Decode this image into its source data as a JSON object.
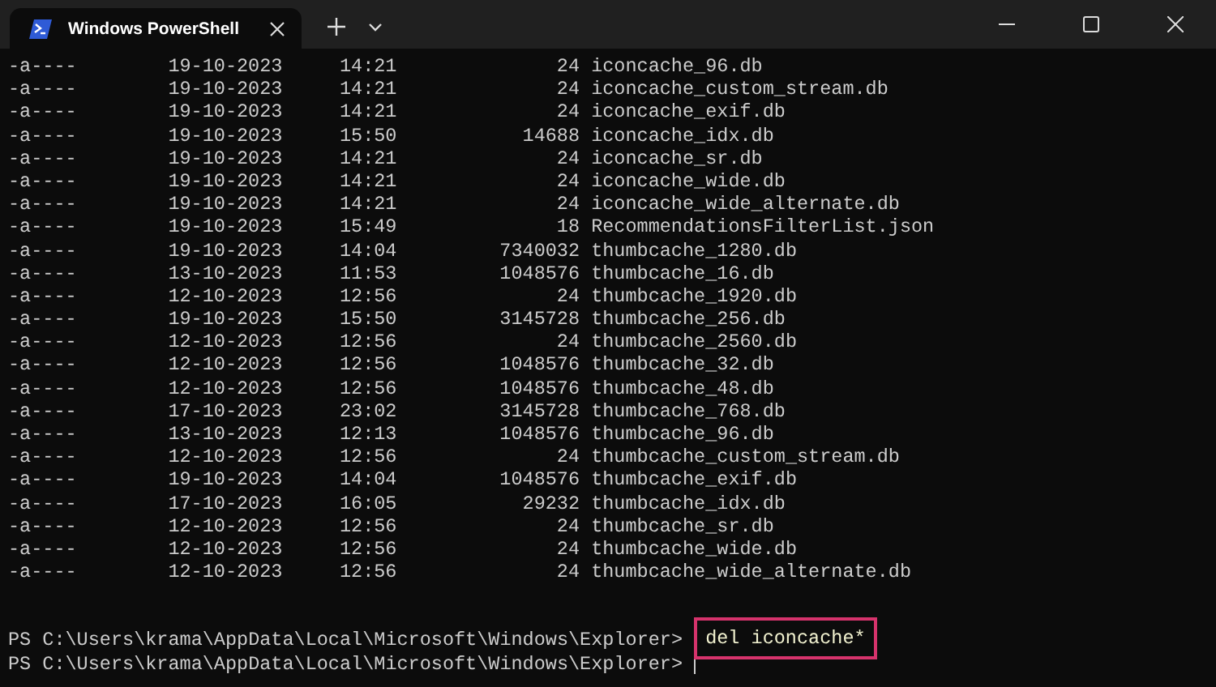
{
  "tabs": [
    {
      "title": "Windows PowerShell",
      "selected": true
    }
  ],
  "listing": [
    {
      "mode": "-a----",
      "date": "19-10-2023",
      "time": "14:21",
      "length": "24",
      "name": "iconcache_96.db"
    },
    {
      "mode": "-a----",
      "date": "19-10-2023",
      "time": "14:21",
      "length": "24",
      "name": "iconcache_custom_stream.db"
    },
    {
      "mode": "-a----",
      "date": "19-10-2023",
      "time": "14:21",
      "length": "24",
      "name": "iconcache_exif.db"
    },
    {
      "mode": "-a----",
      "date": "19-10-2023",
      "time": "15:50",
      "length": "14688",
      "name": "iconcache_idx.db"
    },
    {
      "mode": "-a----",
      "date": "19-10-2023",
      "time": "14:21",
      "length": "24",
      "name": "iconcache_sr.db"
    },
    {
      "mode": "-a----",
      "date": "19-10-2023",
      "time": "14:21",
      "length": "24",
      "name": "iconcache_wide.db"
    },
    {
      "mode": "-a----",
      "date": "19-10-2023",
      "time": "14:21",
      "length": "24",
      "name": "iconcache_wide_alternate.db"
    },
    {
      "mode": "-a----",
      "date": "19-10-2023",
      "time": "15:49",
      "length": "18",
      "name": "RecommendationsFilterList.json"
    },
    {
      "mode": "-a----",
      "date": "19-10-2023",
      "time": "14:04",
      "length": "7340032",
      "name": "thumbcache_1280.db"
    },
    {
      "mode": "-a----",
      "date": "13-10-2023",
      "time": "11:53",
      "length": "1048576",
      "name": "thumbcache_16.db"
    },
    {
      "mode": "-a----",
      "date": "12-10-2023",
      "time": "12:56",
      "length": "24",
      "name": "thumbcache_1920.db"
    },
    {
      "mode": "-a----",
      "date": "19-10-2023",
      "time": "15:50",
      "length": "3145728",
      "name": "thumbcache_256.db"
    },
    {
      "mode": "-a----",
      "date": "12-10-2023",
      "time": "12:56",
      "length": "24",
      "name": "thumbcache_2560.db"
    },
    {
      "mode": "-a----",
      "date": "12-10-2023",
      "time": "12:56",
      "length": "1048576",
      "name": "thumbcache_32.db"
    },
    {
      "mode": "-a----",
      "date": "12-10-2023",
      "time": "12:56",
      "length": "1048576",
      "name": "thumbcache_48.db"
    },
    {
      "mode": "-a----",
      "date": "17-10-2023",
      "time": "23:02",
      "length": "3145728",
      "name": "thumbcache_768.db"
    },
    {
      "mode": "-a----",
      "date": "13-10-2023",
      "time": "12:13",
      "length": "1048576",
      "name": "thumbcache_96.db"
    },
    {
      "mode": "-a----",
      "date": "12-10-2023",
      "time": "12:56",
      "length": "24",
      "name": "thumbcache_custom_stream.db"
    },
    {
      "mode": "-a----",
      "date": "19-10-2023",
      "time": "14:04",
      "length": "1048576",
      "name": "thumbcache_exif.db"
    },
    {
      "mode": "-a----",
      "date": "17-10-2023",
      "time": "16:05",
      "length": "29232",
      "name": "thumbcache_idx.db"
    },
    {
      "mode": "-a----",
      "date": "12-10-2023",
      "time": "12:56",
      "length": "24",
      "name": "thumbcache_sr.db"
    },
    {
      "mode": "-a----",
      "date": "12-10-2023",
      "time": "12:56",
      "length": "24",
      "name": "thumbcache_wide.db"
    },
    {
      "mode": "-a----",
      "date": "12-10-2023",
      "time": "12:56",
      "length": "24",
      "name": "thumbcache_wide_alternate.db"
    }
  ],
  "prompts": [
    {
      "prompt": "PS C:\\Users\\krama\\AppData\\Local\\Microsoft\\Windows\\Explorer>",
      "command": "del iconcache*",
      "highlighted": true,
      "cursor": false
    },
    {
      "prompt": "PS C:\\Users\\krama\\AppData\\Local\\Microsoft\\Windows\\Explorer>",
      "cursor": true
    }
  ]
}
